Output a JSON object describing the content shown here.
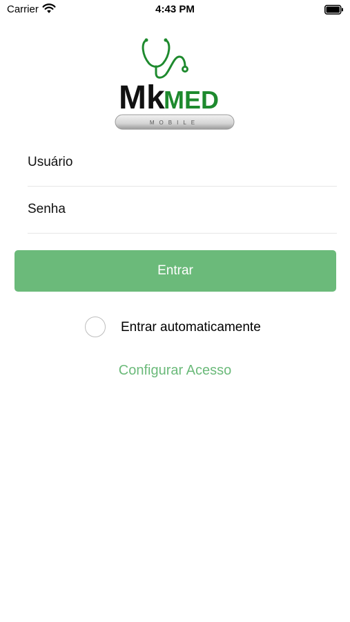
{
  "status_bar": {
    "carrier": "Carrier",
    "time": "4:43 PM",
    "battery_icon": "battery-full-icon",
    "wifi_icon": "wifi-icon"
  },
  "logo": {
    "text_mk": "Mk",
    "text_med": "MED",
    "subtitle": "MOBILE"
  },
  "form": {
    "username_placeholder": "Usuário",
    "username_value": "",
    "password_placeholder": "Senha",
    "password_value": "",
    "login_label": "Entrar",
    "auto_login_label": "Entrar automaticamente",
    "auto_login_checked": false,
    "config_link": "Configurar Acesso"
  },
  "colors": {
    "accent": "#6bba7a",
    "logo_green": "#1e8a2e",
    "logo_dark": "#111111"
  }
}
